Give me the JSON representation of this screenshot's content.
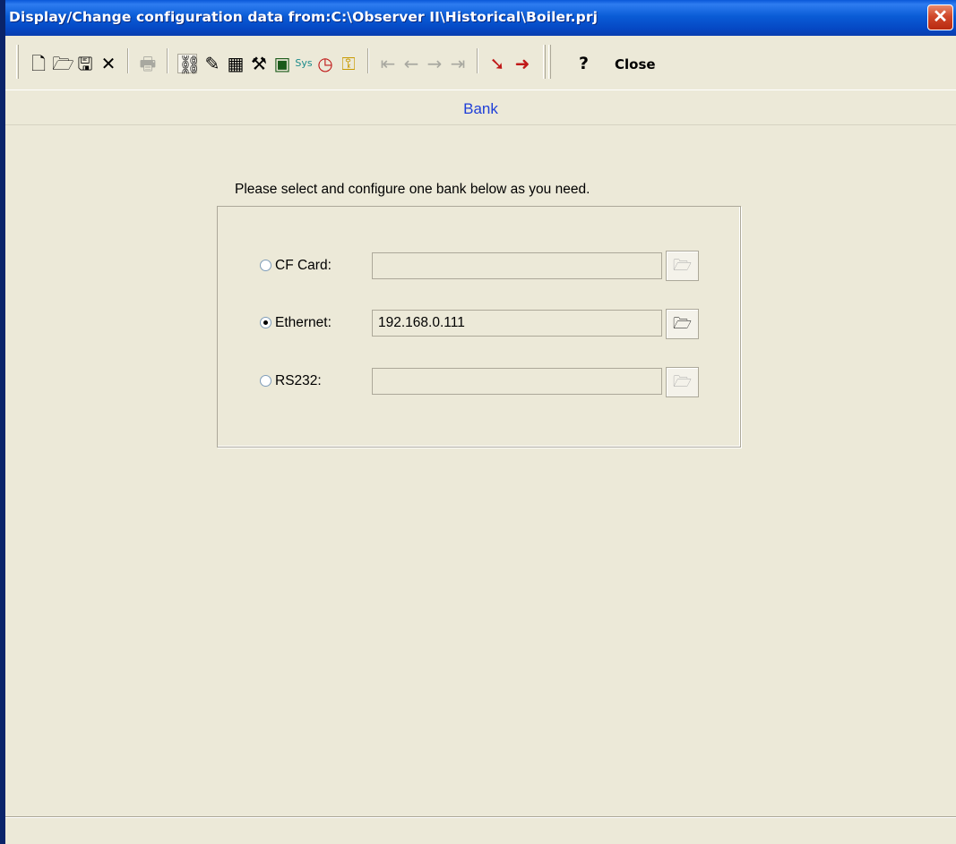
{
  "window": {
    "title": "Display/Change configuration data from:C:\\Observer II\\Historical\\Boiler.prj",
    "close_glyph": "✕"
  },
  "toolbar": {
    "icons": [
      {
        "name": "new-file-icon",
        "glyph": "🗋"
      },
      {
        "name": "open-folder-icon",
        "glyph": "🗁"
      },
      {
        "name": "save-icon",
        "glyph": "🖫"
      },
      {
        "name": "delete-icon",
        "glyph": "✕"
      },
      {
        "name": "print-icon",
        "glyph": "🖶"
      },
      {
        "name": "network-icon",
        "glyph": "⛓"
      },
      {
        "name": "pencil-icon",
        "glyph": "✎"
      },
      {
        "name": "calculator-icon",
        "glyph": "▦"
      },
      {
        "name": "tools-icon",
        "glyph": "⚒"
      },
      {
        "name": "monitor-icon",
        "glyph": "▣"
      },
      {
        "name": "sys-icon",
        "glyph": "Sys"
      },
      {
        "name": "clock-icon",
        "glyph": "◷"
      },
      {
        "name": "key-icon",
        "glyph": "⚿"
      },
      {
        "name": "first-record-icon",
        "glyph": "⇤"
      },
      {
        "name": "prev-record-icon",
        "glyph": "←"
      },
      {
        "name": "next-record-icon",
        "glyph": "→"
      },
      {
        "name": "last-record-icon",
        "glyph": "⇥"
      },
      {
        "name": "import-icon",
        "glyph": "➘"
      },
      {
        "name": "export-icon",
        "glyph": "➜"
      }
    ],
    "help_label": "?",
    "close_label": "Close"
  },
  "section": {
    "title": "Bank"
  },
  "instruction": "Please select and configure one bank below as you need.",
  "banks": [
    {
      "label": "CF Card:",
      "value": "",
      "selected": false,
      "enabled": false
    },
    {
      "label": "Ethernet:",
      "value": "192.168.0.111",
      "selected": true,
      "enabled": true
    },
    {
      "label": "RS232:",
      "value": "",
      "selected": false,
      "enabled": false
    }
  ],
  "browse_glyph": "🗁"
}
